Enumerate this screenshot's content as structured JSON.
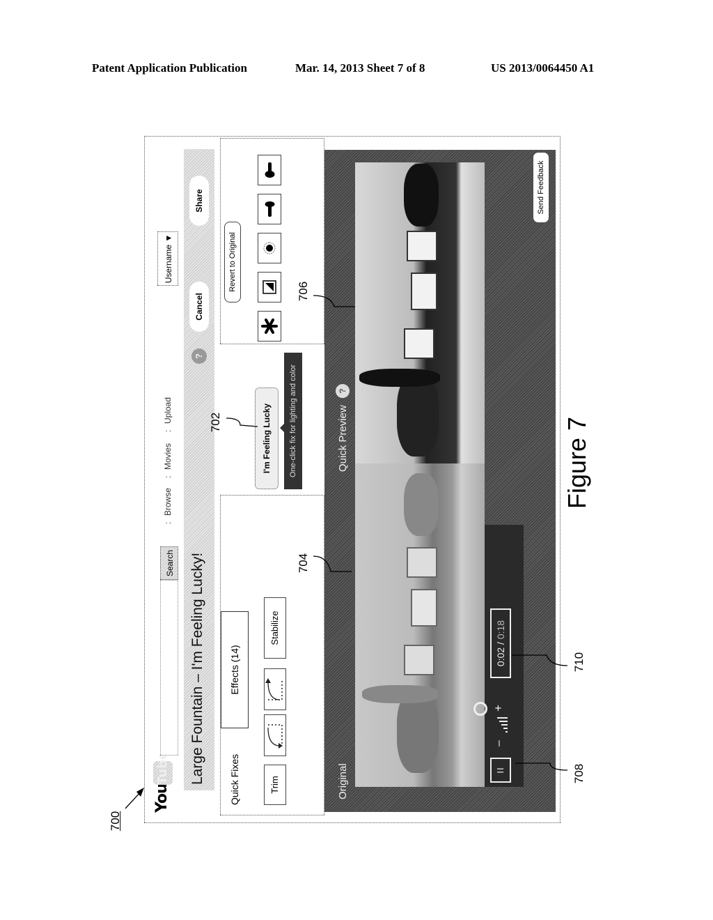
{
  "header": {
    "publication": "Patent Application Publication",
    "date_sheet": "Mar. 14, 2013  Sheet 7 of 8",
    "pub_number": "US 2013/0064450 A1"
  },
  "figure": {
    "caption": "Figure 7",
    "refs": {
      "r700": "700",
      "r702": "702",
      "r704": "704",
      "r706": "706",
      "r708": "708",
      "r710": "710"
    }
  },
  "app": {
    "logo_you": "You",
    "logo_tube": "Tube",
    "search": {
      "placeholder": "",
      "button": "Search"
    },
    "nav": {
      "sep": ":",
      "browse": "Browse",
      "movies": "Movies",
      "upload": "Upload"
    },
    "user_menu": "Username ▼",
    "video_title": "Large Fountain – I'm Feeling Lucky!",
    "help_glyph": "?",
    "cancel": "Cancel",
    "share": "Share",
    "tabs": [
      {
        "label": "Quick Fixes",
        "active": true
      },
      {
        "label": "Effects (14)",
        "active": false
      }
    ],
    "quick_fixes": {
      "trim": "Trim",
      "rotate_left_icon": "rotate-left-icon",
      "rotate_right_icon": "rotate-right-icon",
      "stabilize": "Stabilize"
    },
    "lucky_button": "I'm Feeling Lucky",
    "lucky_tooltip": "One-click fix for lighting and color",
    "revert": "Revert to Original",
    "adjust_icons": [
      "auto-fix-icon",
      "contrast-icon",
      "color-icon",
      "temperature-icon",
      "brightness-icon"
    ],
    "preview": {
      "original_label": "Original",
      "preview_label": "Quick Preview",
      "send_feedback": "Send Feedback",
      "pause_glyph": "II",
      "vol_minus": "–",
      "vol_plus": "+",
      "time_current": "0:02",
      "time_sep": " / ",
      "time_total": "0:18"
    }
  }
}
